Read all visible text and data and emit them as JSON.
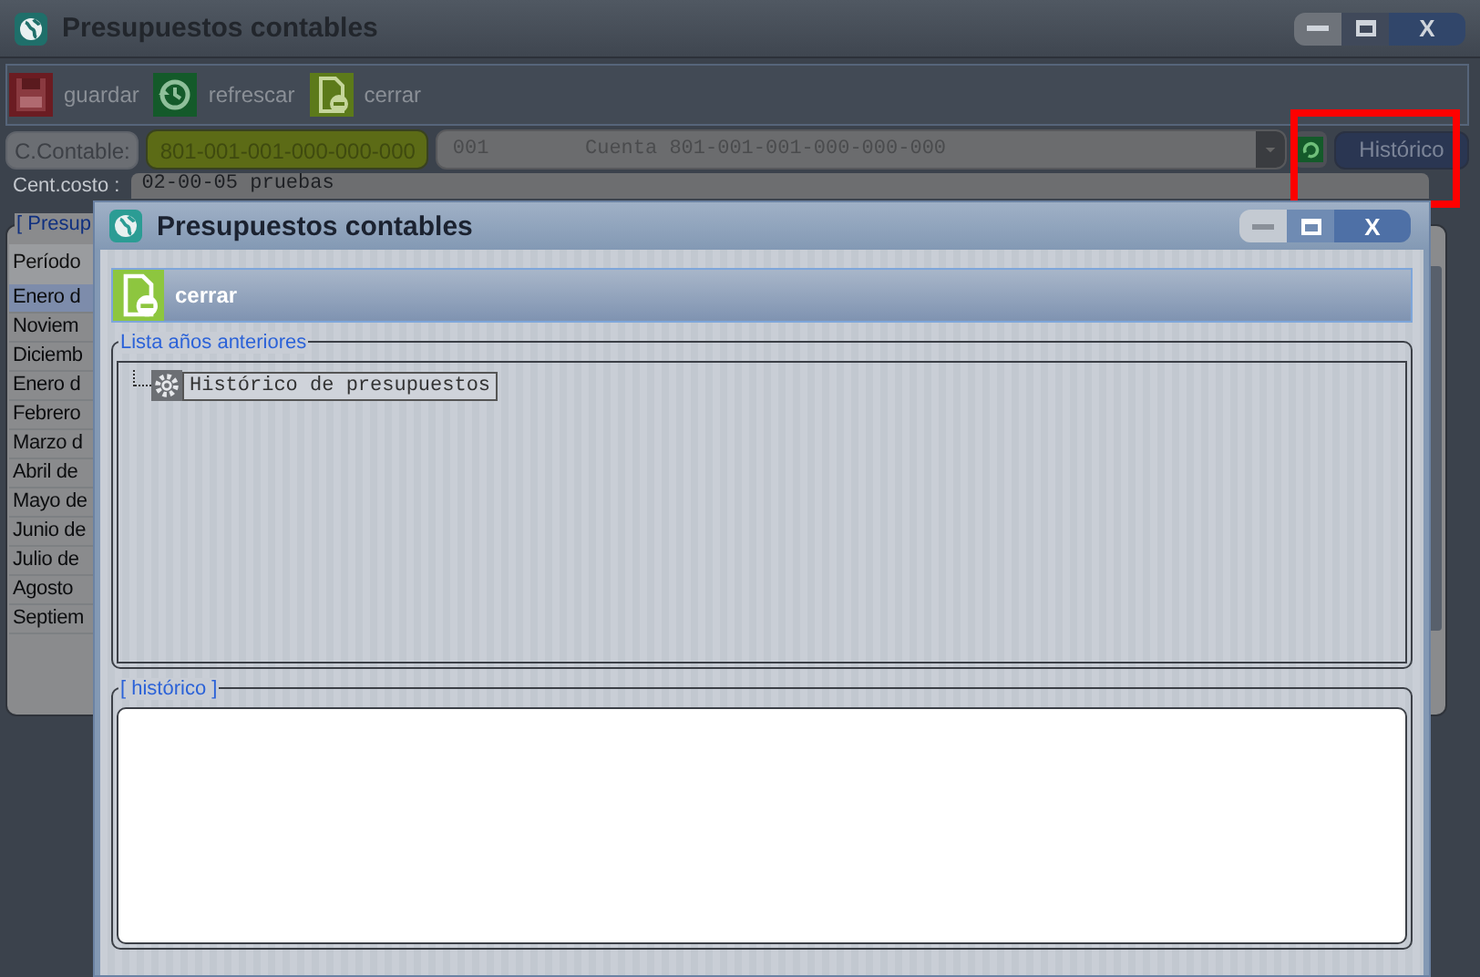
{
  "window": {
    "title": "Presupuestos contables",
    "close_label": "X"
  },
  "toolbar": [
    {
      "kind": "save",
      "label": "guardar"
    },
    {
      "kind": "refresh",
      "label": "refrescar"
    },
    {
      "kind": "close",
      "label": "cerrar"
    }
  ],
  "cuenta": {
    "label": "C.Contable:",
    "code": "801-001-001-000-000-000",
    "description": "001        Cuenta 801-001-001-000-000-000"
  },
  "historico_button": {
    "label": "Histórico",
    "highlighted": true
  },
  "centro_costo": {
    "label": "Cent.costo :",
    "value": "02-00-05 pruebas"
  },
  "presupuestos": {
    "title": "[ Presup",
    "column": "Período",
    "rows": [
      {
        "label": "Enero d",
        "selected": true
      },
      {
        "label": "Noviem",
        "selected": false
      },
      {
        "label": "Diciemb",
        "selected": false
      },
      {
        "label": "Enero d",
        "selected": false
      },
      {
        "label": "Febrero",
        "selected": false
      },
      {
        "label": "Marzo d",
        "selected": false
      },
      {
        "label": "Abril de",
        "selected": false
      },
      {
        "label": "Mayo de",
        "selected": false
      },
      {
        "label": "Junio de",
        "selected": false
      },
      {
        "label": "Julio de",
        "selected": false
      },
      {
        "label": "Agosto",
        "selected": false
      },
      {
        "label": "Septiem",
        "selected": false
      }
    ]
  },
  "dialog": {
    "title": "Presupuestos contables",
    "close_label": "X",
    "toolbar": [
      {
        "kind": "close",
        "label": "cerrar"
      }
    ],
    "tree": {
      "title": "Lista años anteriores",
      "items": [
        {
          "label": "Histórico de presupuestos"
        }
      ]
    },
    "historico": {
      "title": "[ histórico ]"
    }
  }
}
